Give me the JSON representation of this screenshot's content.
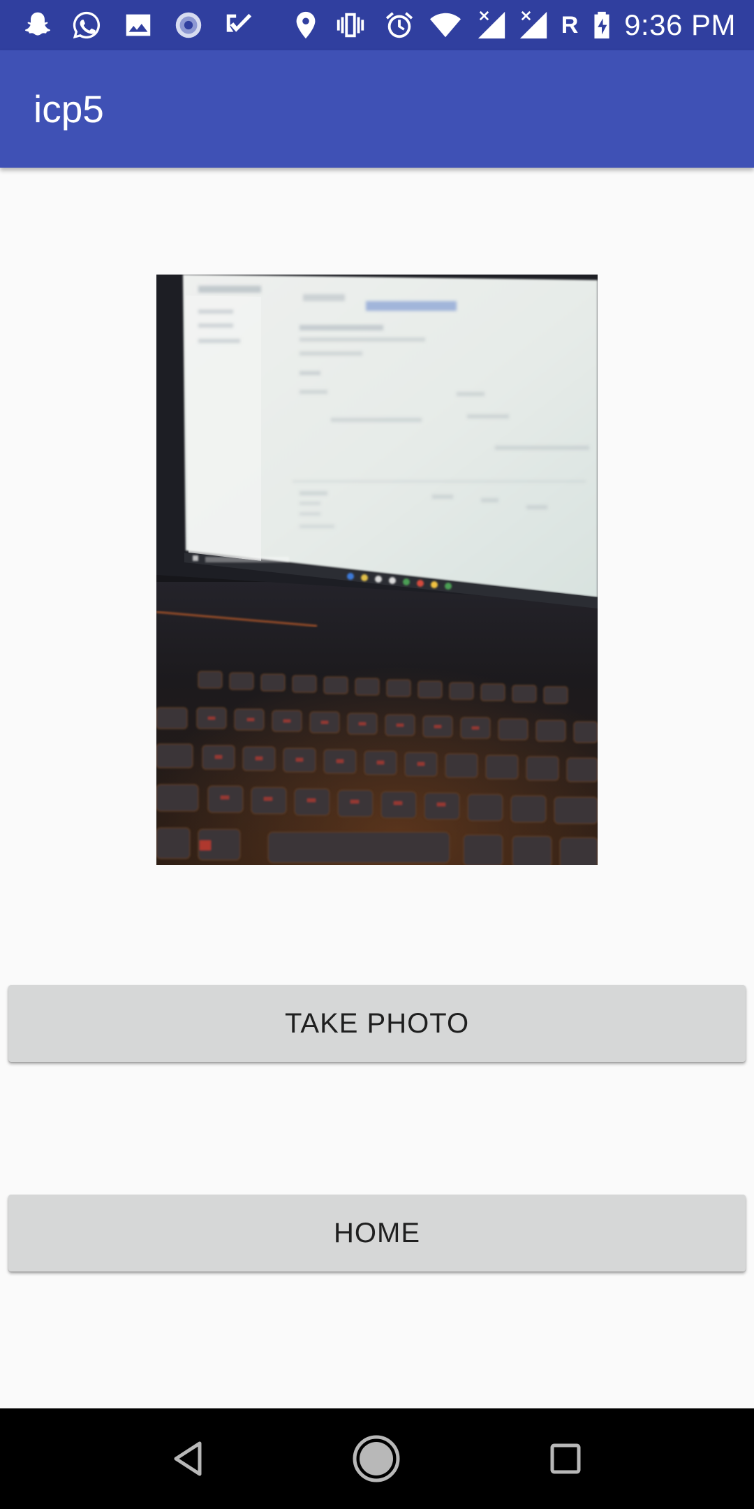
{
  "status_bar": {
    "time": "9:36 PM",
    "icons": [
      "snapchat-icon",
      "whatsapp-icon",
      "gallery-icon",
      "sync-progress-icon",
      "checklist-icon",
      "location-icon",
      "vibrate-icon",
      "alarm-icon",
      "wifi-icon",
      "signal-no-data-icon",
      "signal-no-data-icon",
      "roaming-r-icon",
      "battery-charging-icon"
    ],
    "roaming_label": "R",
    "background": "#303f9f"
  },
  "app_bar": {
    "title": "icp5",
    "background": "#3f51b5"
  },
  "photo": {
    "subject": "laptop-screen-and-keyboard-photo"
  },
  "buttons": {
    "take_photo": "TAKE PHOTO",
    "home": "HOME"
  },
  "nav_bar": {
    "back": "back-icon",
    "home": "home-circle-icon",
    "recents": "recents-square-icon"
  }
}
